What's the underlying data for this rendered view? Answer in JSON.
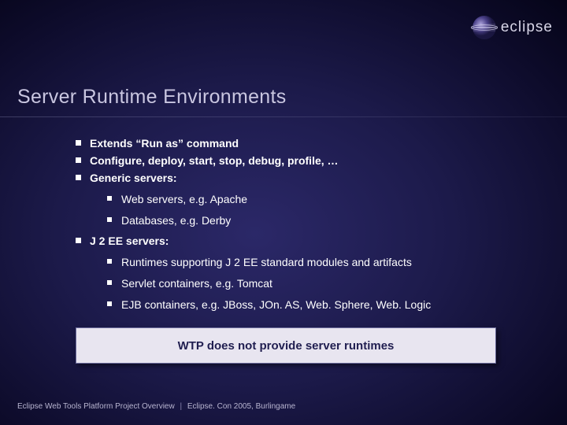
{
  "logo_text": "eclipse",
  "title": "Server Runtime Environments",
  "bullets": {
    "b0": "Extends “Run as” command",
    "b1": "Configure, deploy, start, stop, debug, profile, …",
    "b2": "Generic servers:",
    "b2_0": "Web servers, e.g. Apache",
    "b2_1": "Databases, e.g. Derby",
    "b3": "J 2 EE servers:",
    "b3_0": "Runtimes supporting J 2 EE standard modules and artifacts",
    "b3_1": "Servlet containers, e.g. Tomcat",
    "b3_2": "EJB containers, e.g. JBoss, JOn. AS, Web. Sphere, Web. Logic"
  },
  "callout": "WTP does not provide server runtimes",
  "footer_left": "Eclipse Web Tools Platform Project Overview",
  "footer_right": "Eclipse. Con 2005, Burlingame"
}
